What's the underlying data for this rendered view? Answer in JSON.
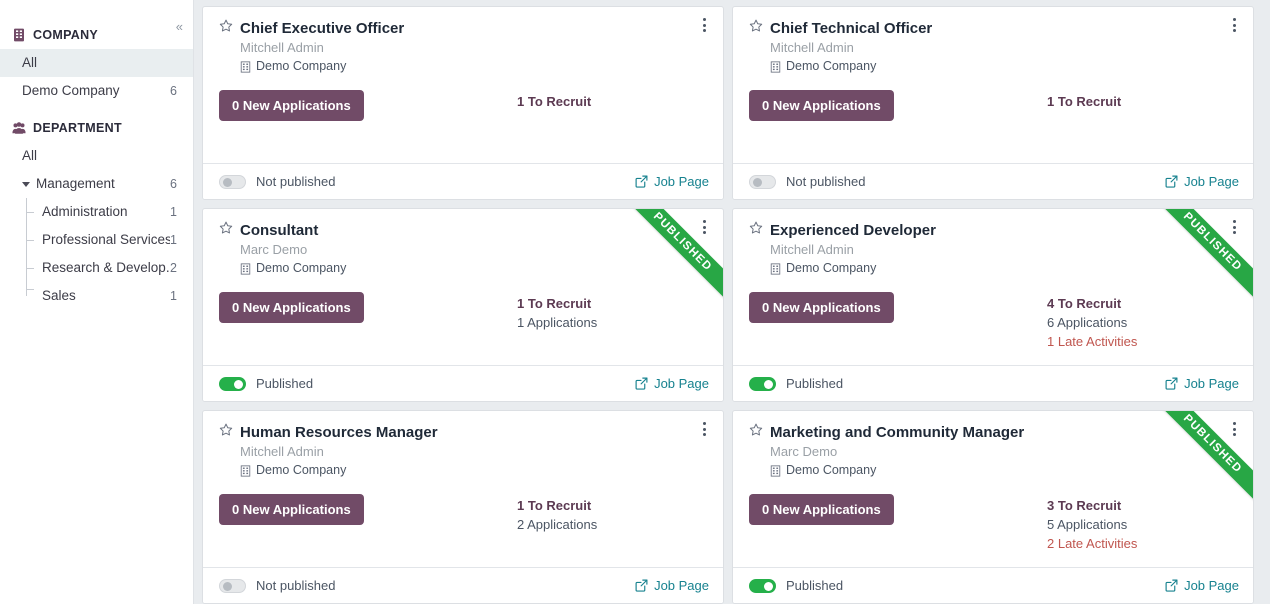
{
  "sidebar": {
    "collapse_icon": "chevrons-left-icon",
    "sections": [
      {
        "icon": "building-icon",
        "title": "COMPANY",
        "items": [
          {
            "label": "All",
            "count": "",
            "active": true,
            "child": false
          },
          {
            "label": "Demo Company",
            "count": "6",
            "active": false,
            "child": false
          }
        ]
      },
      {
        "icon": "users-icon",
        "title": "DEPARTMENT",
        "items": [
          {
            "label": "All",
            "count": "",
            "active": false,
            "child": false,
            "caret": false
          },
          {
            "label": "Management",
            "count": "6",
            "active": false,
            "child": false,
            "caret": true
          },
          {
            "label": "Administration",
            "count": "1",
            "active": false,
            "child": true
          },
          {
            "label": "Professional Services",
            "count": "1",
            "active": false,
            "child": true
          },
          {
            "label": "Research & Develop...",
            "count": "2",
            "active": false,
            "child": true
          },
          {
            "label": "Sales",
            "count": "1",
            "active": false,
            "child": true,
            "last": true
          }
        ]
      }
    ]
  },
  "colors": {
    "primary": "#714b67",
    "published_green": "#28a745",
    "toggle_on": "#25b04a",
    "link_teal": "#17828f",
    "late_red": "#c0564f",
    "recruit_purple": "#5c3a52"
  },
  "labels": {
    "job_page": "Job Page",
    "published": "Published",
    "not_published": "Not published",
    "ribbon": "PUBLISHED",
    "star_icon": "star-outline-icon",
    "menu_icon": "vertical-dots-icon",
    "external_link_icon": "external-link-icon",
    "company_icon": "building-icon"
  },
  "cards": [
    {
      "title": "Chief Executive Officer",
      "manager": "Mitchell Admin",
      "company": "Demo Company",
      "new_applications": "0 New Applications",
      "to_recruit": "1 To Recruit",
      "applications": "",
      "late_activities": "",
      "published": false,
      "status_label": "Not published",
      "ribbon": false
    },
    {
      "title": "Chief Technical Officer",
      "manager": "Mitchell Admin",
      "company": "Demo Company",
      "new_applications": "0 New Applications",
      "to_recruit": "1 To Recruit",
      "applications": "",
      "late_activities": "",
      "published": false,
      "status_label": "Not published",
      "ribbon": false
    },
    {
      "title": "Consultant",
      "manager": "Marc Demo",
      "company": "Demo Company",
      "new_applications": "0 New Applications",
      "to_recruit": "1 To Recruit",
      "applications": "1 Applications",
      "late_activities": "",
      "published": true,
      "status_label": "Published",
      "ribbon": true
    },
    {
      "title": "Experienced Developer",
      "manager": "Mitchell Admin",
      "company": "Demo Company",
      "new_applications": "0 New Applications",
      "to_recruit": "4 To Recruit",
      "applications": "6 Applications",
      "late_activities": "1 Late Activities",
      "published": true,
      "status_label": "Published",
      "ribbon": true
    },
    {
      "title": "Human Resources Manager",
      "manager": "Mitchell Admin",
      "company": "Demo Company",
      "new_applications": "0 New Applications",
      "to_recruit": "1 To Recruit",
      "applications": "2 Applications",
      "late_activities": "",
      "published": false,
      "status_label": "Not published",
      "ribbon": false
    },
    {
      "title": "Marketing and Community Manager",
      "manager": "Marc Demo",
      "company": "Demo Company",
      "new_applications": "0 New Applications",
      "to_recruit": "3 To Recruit",
      "applications": "5 Applications",
      "late_activities": "2 Late Activities",
      "published": true,
      "status_label": "Published",
      "ribbon": true
    }
  ]
}
